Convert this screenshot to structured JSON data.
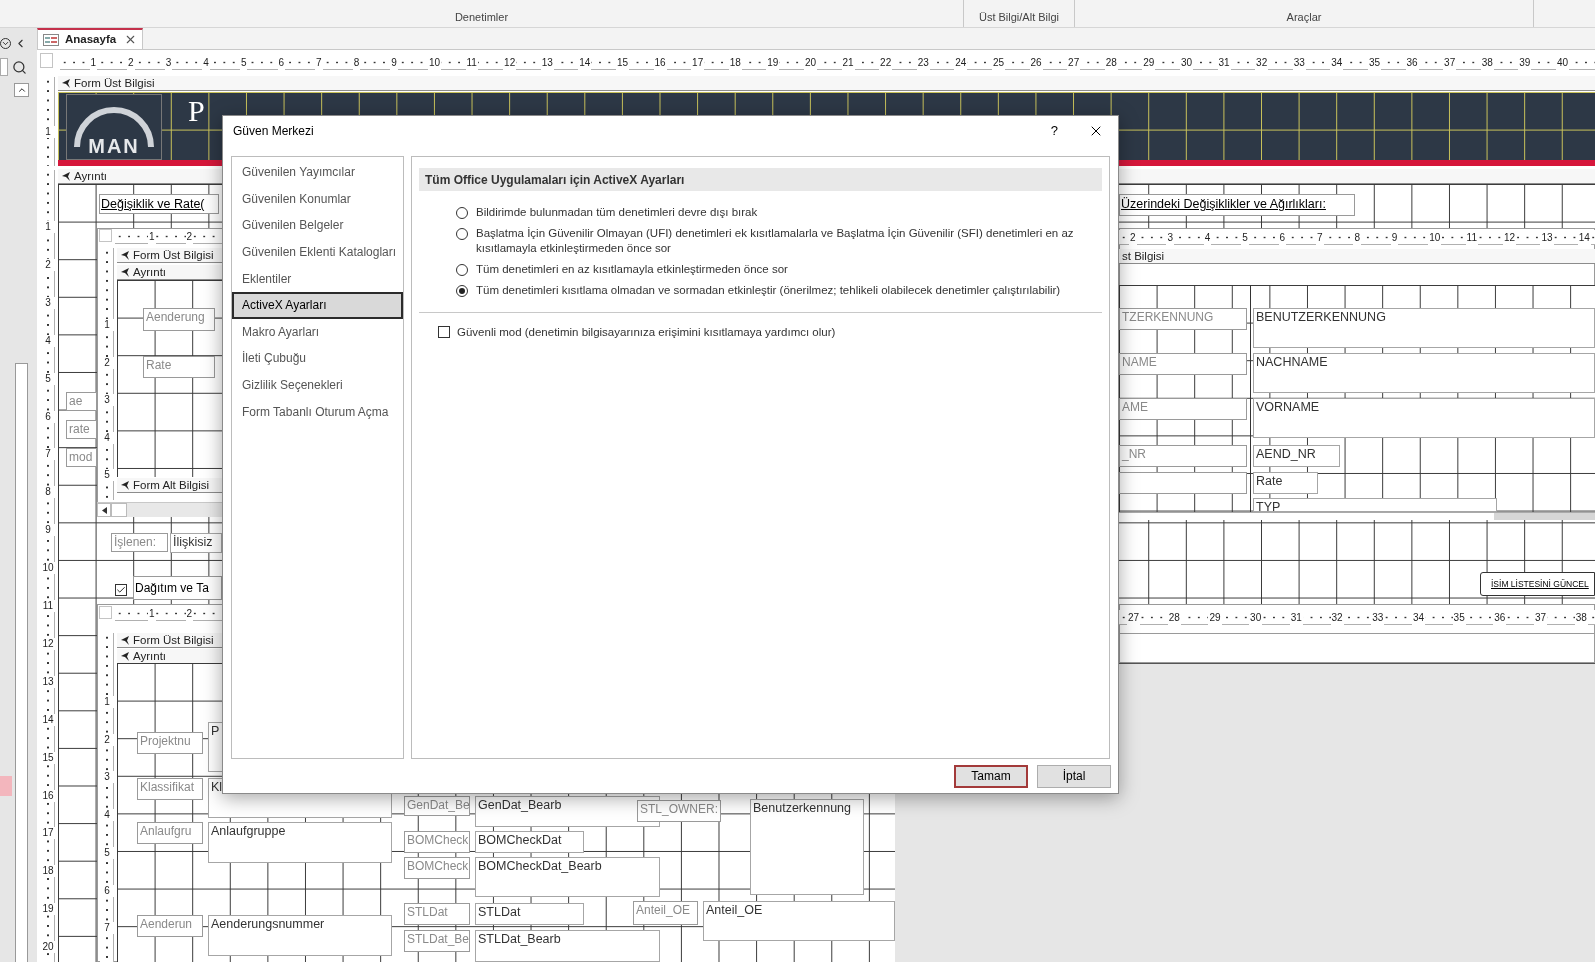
{
  "ribbon": {
    "groups": [
      "Denetimler",
      "Üst Bilgi/Alt Bilgi",
      "Araçlar"
    ]
  },
  "document_tabs": [
    {
      "label": "Anasayfa",
      "selected": true
    }
  ],
  "form_design": {
    "ruler": [
      "1",
      "2",
      "3",
      "4",
      "5",
      "6",
      "7",
      "8",
      "9",
      "10",
      "11",
      "12",
      "13",
      "14",
      "15",
      "16",
      "17",
      "18",
      "19",
      "20",
      "21",
      "22",
      "23",
      "24",
      "25",
      "26",
      "27",
      "28",
      "29",
      "30",
      "31",
      "32",
      "33",
      "34",
      "35",
      "36",
      "37",
      "38",
      "39",
      "40"
    ],
    "vertical_ruler_header": [
      "1"
    ],
    "vertical_ruler_detail": [
      "1",
      "2",
      "3",
      "4",
      "5",
      "6",
      "7",
      "8",
      "9",
      "10",
      "11",
      "12",
      "13",
      "14",
      "15",
      "16",
      "17",
      "18",
      "19",
      "20"
    ],
    "header_section": "Form Üst Bilgisi",
    "header_logo": "MAN",
    "header_title": "P",
    "detail_section": "Ayrıntı",
    "controls": [
      {
        "kind": "heading_label",
        "text": "Değişiklik ve Rate("
      },
      {
        "kind": "heading_label",
        "text": "Üzerindeki Değişiklikler ve Ağırlıkları:"
      },
      {
        "kind": "label",
        "text": "ae"
      },
      {
        "kind": "label",
        "text": "rate"
      },
      {
        "kind": "label",
        "text": "mod"
      },
      {
        "kind": "label",
        "text": "İşlenen:"
      },
      {
        "kind": "textbox",
        "text": "İlişkisiz"
      },
      {
        "kind": "checkbox",
        "text": "Dağıtım ve Ta",
        "checked": true
      },
      {
        "kind": "button",
        "text": "İSİM LİSTESİNİ GÜNCEL"
      }
    ],
    "subforms": [
      {
        "ruler": [
          "1",
          "2"
        ],
        "vertical_ruler": [
          "1",
          "2",
          "3",
          "4",
          "5"
        ],
        "sections": [
          "Form Üst Bilgisi",
          "Ayrıntı",
          "Form Alt Bilgisi"
        ],
        "controls": [
          {
            "kind": "label",
            "text": "Aenderung"
          },
          {
            "kind": "label",
            "text": "Rate"
          }
        ]
      },
      {
        "ruler": [
          "2",
          "3",
          "4",
          "5",
          "6",
          "7",
          "8",
          "9",
          "10",
          "11",
          "12",
          "13",
          "14"
        ],
        "sections": [
          "st Bilgisi"
        ],
        "controls": [
          {
            "kind": "label",
            "text": "TZERKENNUNG"
          },
          {
            "kind": "textbox",
            "text": "BENUTZERKENNUNG"
          },
          {
            "kind": "label",
            "text": "NAME"
          },
          {
            "kind": "textbox",
            "text": "NACHNAME"
          },
          {
            "kind": "label",
            "text": "AME"
          },
          {
            "kind": "textbox",
            "text": "VORNAME"
          },
          {
            "kind": "label",
            "text": "_NR"
          },
          {
            "kind": "textbox",
            "text": "AEND_NR"
          },
          {
            "kind": "textbox",
            "text": "Rate"
          },
          {
            "kind": "textbox",
            "text": "TYP"
          }
        ]
      },
      {
        "ruler": [
          "1",
          "2"
        ],
        "vertical_ruler": [
          "1",
          "2",
          "3",
          "4",
          "5",
          "6",
          "7"
        ],
        "sections": [
          "Form Üst Bilgisi",
          "Ayrıntı"
        ],
        "controls": [
          {
            "kind": "label",
            "text": "Projektnu"
          },
          {
            "kind": "textbox",
            "text": "P"
          },
          {
            "kind": "label",
            "text": "Klassifikat"
          },
          {
            "kind": "textbox",
            "text": "Kl"
          },
          {
            "kind": "label",
            "text": "Anlaufgru"
          },
          {
            "kind": "textbox",
            "text": "Anlaufgruppe"
          },
          {
            "kind": "label",
            "text": "Aenderun"
          },
          {
            "kind": "textbox",
            "text": "Aenderungsnummer"
          },
          {
            "kind": "label",
            "text": "GenDat_Be"
          },
          {
            "kind": "textbox",
            "text": "GenDat_Bearb"
          },
          {
            "kind": "label",
            "text": "BOMCheck"
          },
          {
            "kind": "textbox",
            "text": "BOMCheckDat"
          },
          {
            "kind": "label",
            "text": "BOMCheck"
          },
          {
            "kind": "textbox",
            "text": "BOMCheckDat_Bearb"
          },
          {
            "kind": "label",
            "text": "STL_OWNER:"
          },
          {
            "kind": "textbox",
            "text": "Benutzerkennung"
          },
          {
            "kind": "label",
            "text": "STLDat"
          },
          {
            "kind": "textbox",
            "text": "STLDat"
          },
          {
            "kind": "label",
            "text": "Anteil_OE"
          },
          {
            "kind": "textbox",
            "text": "Anteil_OE"
          },
          {
            "kind": "label",
            "text": "STLDat_Be"
          },
          {
            "kind": "textbox",
            "text": "STLDat_Bearb"
          }
        ]
      },
      {
        "ruler": [
          "27",
          "28",
          "29",
          "30",
          "31",
          "32",
          "33",
          "34",
          "35",
          "36",
          "37",
          "38"
        ]
      }
    ]
  },
  "dialog": {
    "title": "Güven Merkezi",
    "help_button": "?",
    "nav_items": [
      {
        "label": "Güvenilen Yayımcılar",
        "selected": false
      },
      {
        "label": "Güvenilen Konumlar",
        "selected": false
      },
      {
        "label": "Güvenilen Belgeler",
        "selected": false
      },
      {
        "label": "Güvenilen Eklenti Katalogları",
        "selected": false
      },
      {
        "label": "Eklentiler",
        "selected": false
      },
      {
        "label": "ActiveX Ayarları",
        "selected": true
      },
      {
        "label": "Makro Ayarları",
        "selected": false
      },
      {
        "label": "İleti Çubuğu",
        "selected": false
      },
      {
        "label": "Gizlilik Seçenekleri",
        "selected": false
      },
      {
        "label": "Form Tabanlı Oturum Açma",
        "selected": false
      }
    ],
    "section_title": "Tüm Office Uygulamaları için ActiveX Ayarları",
    "activex_options": [
      {
        "label": "Bildirimde bulunmadan tüm denetimleri devre dışı bırak",
        "selected": false
      },
      {
        "label": "Başlatma İçin Güvenilir Olmayan (UFI) denetimleri ek kısıtlamalarla ve Başlatma İçin Güvenilir (SFI) denetimleri en az kısıtlamayla etkinleştirmeden önce sor",
        "selected": false
      },
      {
        "label": "Tüm denetimleri en az kısıtlamayla etkinleştirmeden önce sor",
        "selected": false
      },
      {
        "label": "Tüm denetimleri kısıtlama olmadan ve sormadan etkinleştir (önerilmez; tehlikeli olabilecek denetimler çalıştırılabilir)",
        "selected": true
      }
    ],
    "safe_mode": {
      "label": "Güvenli mod (denetimin bilgisayarınıza erişimini kısıtlamaya yardımcı olur)",
      "checked": false
    },
    "buttons": [
      {
        "label": "Tamam",
        "kind": "default"
      },
      {
        "label": "İptal",
        "kind": "normal"
      }
    ]
  }
}
